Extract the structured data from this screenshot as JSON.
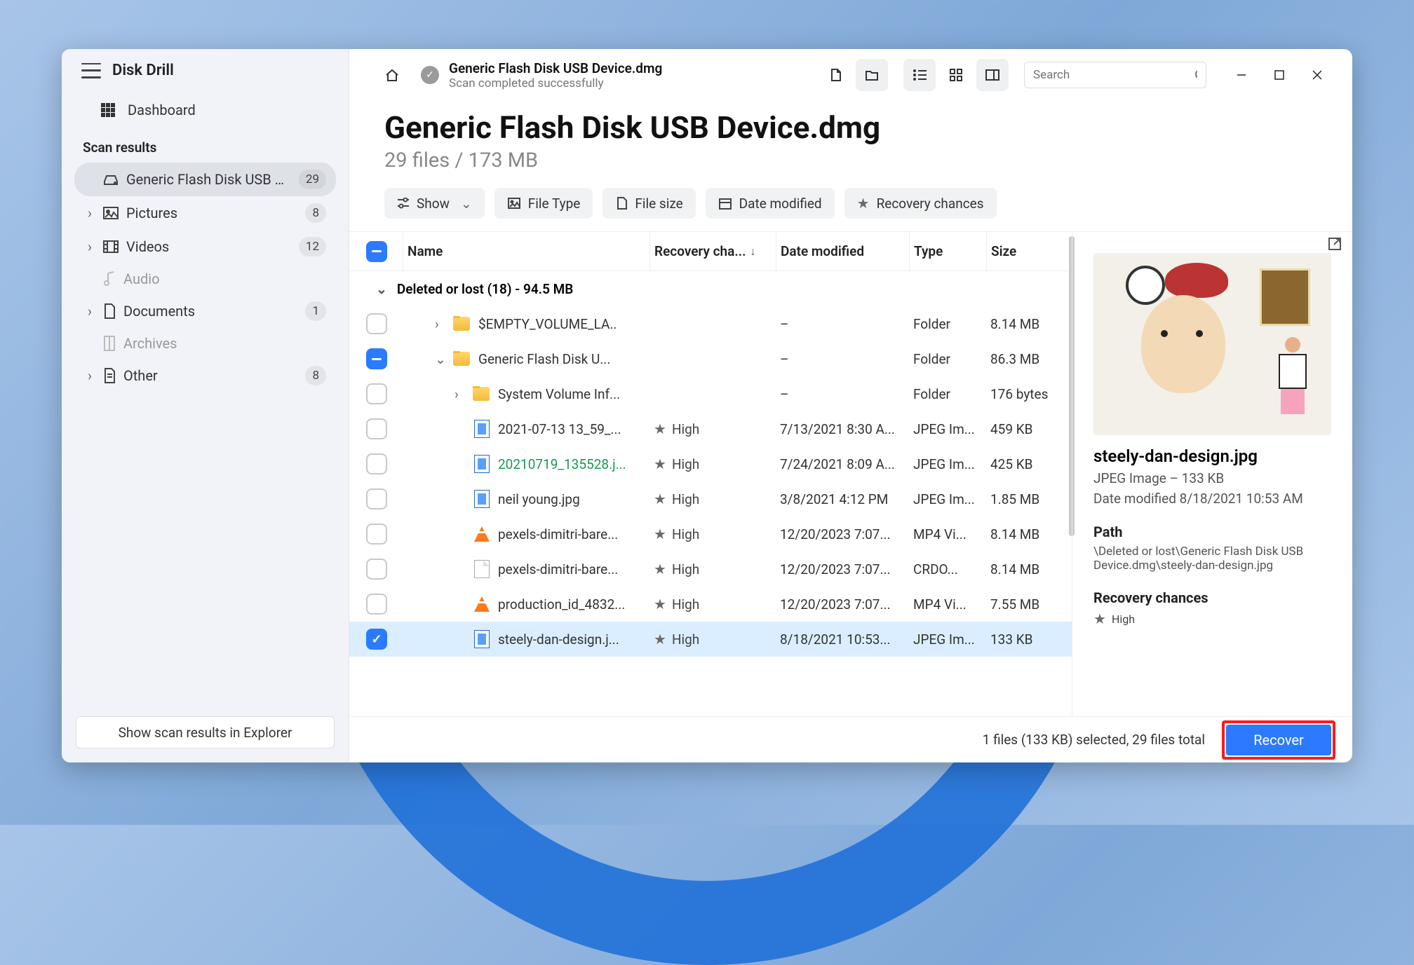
{
  "app": {
    "title": "Disk Drill"
  },
  "sidebar": {
    "dashboard": "Dashboard",
    "scan_label": "Scan results",
    "items": [
      {
        "label": "Generic Flash Disk USB D...",
        "badge": "29",
        "active": true,
        "expand": ""
      },
      {
        "label": "Pictures",
        "badge": "8",
        "expand": "›"
      },
      {
        "label": "Videos",
        "badge": "12",
        "expand": "›"
      },
      {
        "label": "Audio",
        "badge": "",
        "expand": "",
        "muted": true
      },
      {
        "label": "Documents",
        "badge": "1",
        "expand": "›"
      },
      {
        "label": "Archives",
        "badge": "",
        "expand": "",
        "muted": true
      },
      {
        "label": "Other",
        "badge": "8",
        "expand": "›"
      }
    ],
    "footer_btn": "Show scan results in Explorer"
  },
  "toolbar": {
    "crumb_title": "Generic Flash Disk USB Device.dmg",
    "crumb_sub": "Scan completed successfully",
    "search_placeholder": "Search"
  },
  "page": {
    "title": "Generic Flash Disk USB Device.dmg",
    "subtitle": "29 files / 173 MB"
  },
  "filters": {
    "show": "Show",
    "filetype": "File Type",
    "filesize": "File size",
    "datemod": "Date modified",
    "recovery": "Recovery chances"
  },
  "columns": {
    "name": "Name",
    "recovery": "Recovery cha...",
    "date": "Date modified",
    "type": "Type",
    "size": "Size"
  },
  "group_label": "Deleted or lost (18) - 94.5 MB",
  "rows": [
    {
      "name": "$EMPTY_VOLUME_LA..",
      "recovery": "",
      "date": "–",
      "type": "Folder",
      "size": "8.14 MB",
      "icon": "folder",
      "indent": 1,
      "caret": "›",
      "chk": "empty"
    },
    {
      "name": "Generic Flash Disk U...",
      "recovery": "",
      "date": "–",
      "type": "Folder",
      "size": "86.3 MB",
      "icon": "folder",
      "indent": 1,
      "caret": "⌄",
      "chk": "ind"
    },
    {
      "name": "System Volume Inf...",
      "recovery": "",
      "date": "–",
      "type": "Folder",
      "size": "176 bytes",
      "icon": "folder",
      "indent": 2,
      "caret": "›",
      "chk": "empty"
    },
    {
      "name": "2021-07-13 13_59_...",
      "recovery": "High",
      "date": "7/13/2021 8:30 A...",
      "type": "JPEG Im...",
      "size": "459 KB",
      "icon": "jpg",
      "indent": 3,
      "chk": "empty"
    },
    {
      "name": "20210719_135528.j...",
      "recovery": "High",
      "date": "7/24/2021 8:09 A...",
      "type": "JPEG Im...",
      "size": "425 KB",
      "icon": "jpg",
      "indent": 3,
      "chk": "empty",
      "green": true
    },
    {
      "name": "neil young.jpg",
      "recovery": "High",
      "date": "3/8/2021 4:12 PM",
      "type": "JPEG Im...",
      "size": "1.85 MB",
      "icon": "jpg",
      "indent": 3,
      "chk": "empty"
    },
    {
      "name": "pexels-dimitri-bare...",
      "recovery": "High",
      "date": "12/20/2023 7:07...",
      "type": "MP4 Vi...",
      "size": "8.14 MB",
      "icon": "cone",
      "indent": 3,
      "chk": "empty"
    },
    {
      "name": "pexels-dimitri-bare...",
      "recovery": "High",
      "date": "12/20/2023 7:07...",
      "type": "CRDO...",
      "size": "8.14 MB",
      "icon": "doc",
      "indent": 3,
      "chk": "empty"
    },
    {
      "name": "production_id_4832...",
      "recovery": "High",
      "date": "12/20/2023 7:07...",
      "type": "MP4 Vi...",
      "size": "7.55 MB",
      "icon": "cone",
      "indent": 3,
      "chk": "empty"
    },
    {
      "name": "steely-dan-design.j...",
      "recovery": "High",
      "date": "8/18/2021 10:53...",
      "type": "JPEG Im...",
      "size": "133 KB",
      "icon": "jpg",
      "indent": 3,
      "chk": "chk",
      "selected": true
    }
  ],
  "preview": {
    "title": "steely-dan-design.jpg",
    "meta1": "JPEG Image – 133 KB",
    "meta2": "Date modified 8/18/2021 10:53 AM",
    "path_label": "Path",
    "path": "\\Deleted or lost\\Generic Flash Disk USB Device.dmg\\steely-dan-design.jpg",
    "rc_label": "Recovery chances",
    "rc_value": "High"
  },
  "footer": {
    "status": "1 files (133 KB) selected, 29 files total",
    "recover": "Recover"
  }
}
